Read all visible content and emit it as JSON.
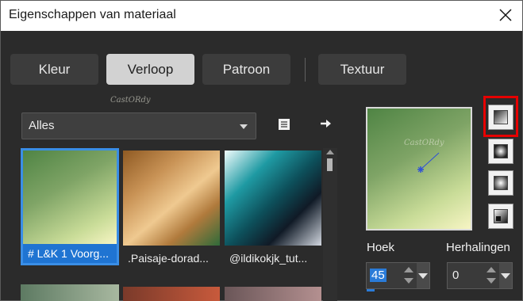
{
  "window": {
    "title": "Eigenschappen van materiaal"
  },
  "tabs": [
    {
      "label": "Kleur"
    },
    {
      "label": "Verloop",
      "active": true
    },
    {
      "label": "Patroon"
    },
    {
      "label": "Textuur"
    }
  ],
  "filter": {
    "value": "Alles"
  },
  "gradients": [
    {
      "label": "# L&K 1 Voorg...",
      "selected": true
    },
    {
      "label": ".Paisaje-dorad..."
    },
    {
      "label": "@ildikokjk_tut..."
    }
  ],
  "watermark": {
    "text": "CastORdy"
  },
  "controls": {
    "angle": {
      "label": "Hoek",
      "value": "45"
    },
    "repeats": {
      "label": "Herhalingen",
      "value": "0"
    }
  },
  "icons": [
    "close-icon",
    "list-icon",
    "arrow-right-icon",
    "scroll-up-icon",
    "linear-gradient-icon",
    "rectangular-gradient-icon",
    "radial-gradient-icon",
    "sunburst-gradient-icon"
  ],
  "colors": {
    "accent": "#1f74d2",
    "highlight": "#e60000",
    "background": "#2b2b2b"
  }
}
